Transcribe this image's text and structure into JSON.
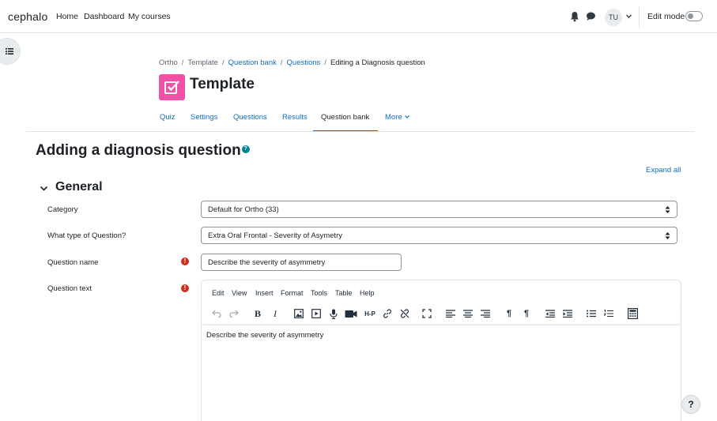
{
  "navbar": {
    "brand": "cephalo",
    "links": [
      "Home",
      "Dashboard",
      "My courses"
    ],
    "user_initials": "TU",
    "edit_mode_label": "Edit mode",
    "edit_mode_on": false
  },
  "breadcrumb": {
    "items": [
      "Ortho",
      "Template",
      "Question bank",
      "Questions",
      "Editing a Diagnosis question"
    ]
  },
  "header": {
    "title": "Template",
    "icon_color": "#f050a5"
  },
  "tabs": [
    "Quiz",
    "Settings",
    "Questions",
    "Results",
    "Question bank",
    "More"
  ],
  "active_tab": "Question bank",
  "form": {
    "heading": "Adding a diagnosis question",
    "expand_all": "Expand all",
    "section_title": "General",
    "fields": {
      "category_label": "Category",
      "category_value": "Default for Ortho (33)",
      "type_label": "What type of Question?",
      "type_value": "Extra Oral Frontal - Severity of Asymetry",
      "name_label": "Question name",
      "name_value": "Describe the severity of asymmetry",
      "text_label": "Question text"
    }
  },
  "editor": {
    "menu": [
      "Edit",
      "View",
      "Insert",
      "Format",
      "Tools",
      "Table",
      "Help"
    ],
    "body_text": "Describe the severity of asymmetry"
  },
  "colors": {
    "link": "#0f6cbf",
    "required": "#ca3120",
    "help": "#008196"
  }
}
